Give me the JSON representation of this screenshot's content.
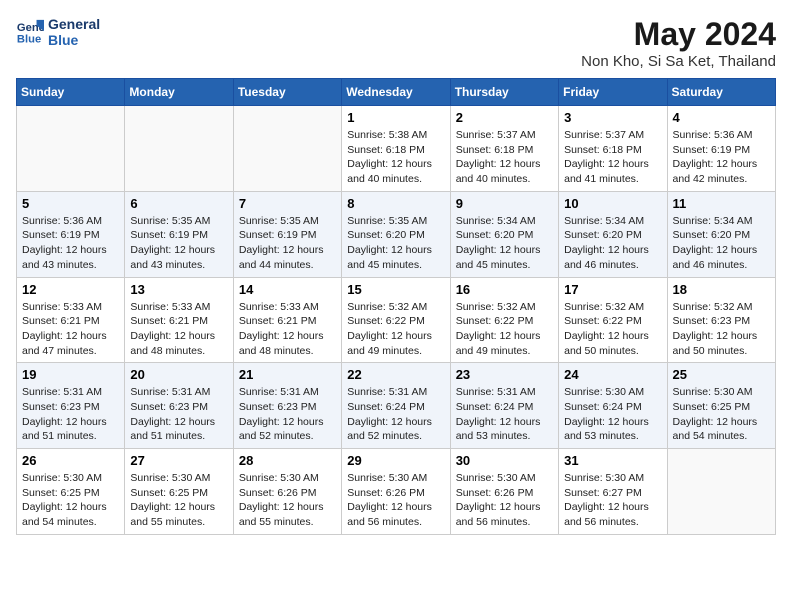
{
  "logo": {
    "line1": "General",
    "line2": "Blue"
  },
  "title": "May 2024",
  "subtitle": "Non Kho, Si Sa Ket, Thailand",
  "days_of_week": [
    "Sunday",
    "Monday",
    "Tuesday",
    "Wednesday",
    "Thursday",
    "Friday",
    "Saturday"
  ],
  "weeks": [
    [
      {
        "day": "",
        "content": ""
      },
      {
        "day": "",
        "content": ""
      },
      {
        "day": "",
        "content": ""
      },
      {
        "day": "1",
        "content": "Sunrise: 5:38 AM\nSunset: 6:18 PM\nDaylight: 12 hours\nand 40 minutes."
      },
      {
        "day": "2",
        "content": "Sunrise: 5:37 AM\nSunset: 6:18 PM\nDaylight: 12 hours\nand 40 minutes."
      },
      {
        "day": "3",
        "content": "Sunrise: 5:37 AM\nSunset: 6:18 PM\nDaylight: 12 hours\nand 41 minutes."
      },
      {
        "day": "4",
        "content": "Sunrise: 5:36 AM\nSunset: 6:19 PM\nDaylight: 12 hours\nand 42 minutes."
      }
    ],
    [
      {
        "day": "5",
        "content": "Sunrise: 5:36 AM\nSunset: 6:19 PM\nDaylight: 12 hours\nand 43 minutes."
      },
      {
        "day": "6",
        "content": "Sunrise: 5:35 AM\nSunset: 6:19 PM\nDaylight: 12 hours\nand 43 minutes."
      },
      {
        "day": "7",
        "content": "Sunrise: 5:35 AM\nSunset: 6:19 PM\nDaylight: 12 hours\nand 44 minutes."
      },
      {
        "day": "8",
        "content": "Sunrise: 5:35 AM\nSunset: 6:20 PM\nDaylight: 12 hours\nand 45 minutes."
      },
      {
        "day": "9",
        "content": "Sunrise: 5:34 AM\nSunset: 6:20 PM\nDaylight: 12 hours\nand 45 minutes."
      },
      {
        "day": "10",
        "content": "Sunrise: 5:34 AM\nSunset: 6:20 PM\nDaylight: 12 hours\nand 46 minutes."
      },
      {
        "day": "11",
        "content": "Sunrise: 5:34 AM\nSunset: 6:20 PM\nDaylight: 12 hours\nand 46 minutes."
      }
    ],
    [
      {
        "day": "12",
        "content": "Sunrise: 5:33 AM\nSunset: 6:21 PM\nDaylight: 12 hours\nand 47 minutes."
      },
      {
        "day": "13",
        "content": "Sunrise: 5:33 AM\nSunset: 6:21 PM\nDaylight: 12 hours\nand 48 minutes."
      },
      {
        "day": "14",
        "content": "Sunrise: 5:33 AM\nSunset: 6:21 PM\nDaylight: 12 hours\nand 48 minutes."
      },
      {
        "day": "15",
        "content": "Sunrise: 5:32 AM\nSunset: 6:22 PM\nDaylight: 12 hours\nand 49 minutes."
      },
      {
        "day": "16",
        "content": "Sunrise: 5:32 AM\nSunset: 6:22 PM\nDaylight: 12 hours\nand 49 minutes."
      },
      {
        "day": "17",
        "content": "Sunrise: 5:32 AM\nSunset: 6:22 PM\nDaylight: 12 hours\nand 50 minutes."
      },
      {
        "day": "18",
        "content": "Sunrise: 5:32 AM\nSunset: 6:23 PM\nDaylight: 12 hours\nand 50 minutes."
      }
    ],
    [
      {
        "day": "19",
        "content": "Sunrise: 5:31 AM\nSunset: 6:23 PM\nDaylight: 12 hours\nand 51 minutes."
      },
      {
        "day": "20",
        "content": "Sunrise: 5:31 AM\nSunset: 6:23 PM\nDaylight: 12 hours\nand 51 minutes."
      },
      {
        "day": "21",
        "content": "Sunrise: 5:31 AM\nSunset: 6:23 PM\nDaylight: 12 hours\nand 52 minutes."
      },
      {
        "day": "22",
        "content": "Sunrise: 5:31 AM\nSunset: 6:24 PM\nDaylight: 12 hours\nand 52 minutes."
      },
      {
        "day": "23",
        "content": "Sunrise: 5:31 AM\nSunset: 6:24 PM\nDaylight: 12 hours\nand 53 minutes."
      },
      {
        "day": "24",
        "content": "Sunrise: 5:30 AM\nSunset: 6:24 PM\nDaylight: 12 hours\nand 53 minutes."
      },
      {
        "day": "25",
        "content": "Sunrise: 5:30 AM\nSunset: 6:25 PM\nDaylight: 12 hours\nand 54 minutes."
      }
    ],
    [
      {
        "day": "26",
        "content": "Sunrise: 5:30 AM\nSunset: 6:25 PM\nDaylight: 12 hours\nand 54 minutes."
      },
      {
        "day": "27",
        "content": "Sunrise: 5:30 AM\nSunset: 6:25 PM\nDaylight: 12 hours\nand 55 minutes."
      },
      {
        "day": "28",
        "content": "Sunrise: 5:30 AM\nSunset: 6:26 PM\nDaylight: 12 hours\nand 55 minutes."
      },
      {
        "day": "29",
        "content": "Sunrise: 5:30 AM\nSunset: 6:26 PM\nDaylight: 12 hours\nand 56 minutes."
      },
      {
        "day": "30",
        "content": "Sunrise: 5:30 AM\nSunset: 6:26 PM\nDaylight: 12 hours\nand 56 minutes."
      },
      {
        "day": "31",
        "content": "Sunrise: 5:30 AM\nSunset: 6:27 PM\nDaylight: 12 hours\nand 56 minutes."
      },
      {
        "day": "",
        "content": ""
      }
    ]
  ]
}
